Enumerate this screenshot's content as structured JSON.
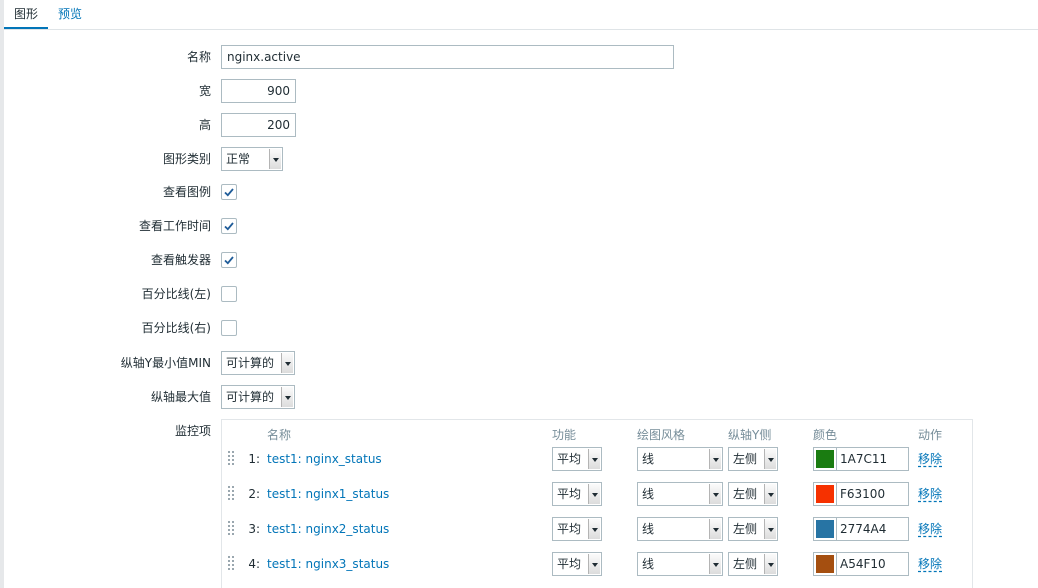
{
  "tabs": [
    {
      "label": "图形",
      "active": true
    },
    {
      "label": "预览",
      "active": false
    }
  ],
  "form": {
    "name_label": "名称",
    "name_value": "nginx.active",
    "width_label": "宽",
    "width_value": "900",
    "height_label": "高",
    "height_value": "200",
    "graph_type_label": "图形类别",
    "graph_type_value": "正常",
    "show_legend_label": "查看图例",
    "show_legend": true,
    "show_working_time_label": "查看工作时间",
    "show_working_time": true,
    "show_triggers_label": "查看触发器",
    "show_triggers": true,
    "percentile_left_label": "百分比线(左)",
    "percentile_left": false,
    "percentile_right_label": "百分比线(右)",
    "percentile_right": false,
    "ymin_label": "纵轴Y最小值MIN",
    "ymin_value": "可计算的",
    "ymax_label": "纵轴最大值",
    "ymax_value": "可计算的",
    "items_label": "监控项"
  },
  "items_table": {
    "headers": {
      "name": "名称",
      "function": "功能",
      "draw_style": "绘图风格",
      "y_axis_side": "纵轴Y侧",
      "color": "颜色",
      "action": "动作"
    },
    "rows": [
      {
        "index": "1:",
        "name": "test1: nginx_status",
        "function": "平均",
        "draw_style": "线",
        "y_axis_side": "左侧",
        "color": "1A7C11",
        "color_hex": "#1A7C11",
        "action": "移除"
      },
      {
        "index": "2:",
        "name": "test1: nginx1_status",
        "function": "平均",
        "draw_style": "线",
        "y_axis_side": "左侧",
        "color": "F63100",
        "color_hex": "#F63100",
        "action": "移除"
      },
      {
        "index": "3:",
        "name": "test1: nginx2_status",
        "function": "平均",
        "draw_style": "线",
        "y_axis_side": "左侧",
        "color": "2774A4",
        "color_hex": "#2774A4",
        "action": "移除"
      },
      {
        "index": "4:",
        "name": "test1: nginx3_status",
        "function": "平均",
        "draw_style": "线",
        "y_axis_side": "左侧",
        "color": "A54F10",
        "color_hex": "#A54F10",
        "action": "移除"
      }
    ]
  },
  "colors": {
    "link": "#0275b8",
    "text": "#1f2c33",
    "header": "#768d99",
    "border": "#acbbc2"
  }
}
